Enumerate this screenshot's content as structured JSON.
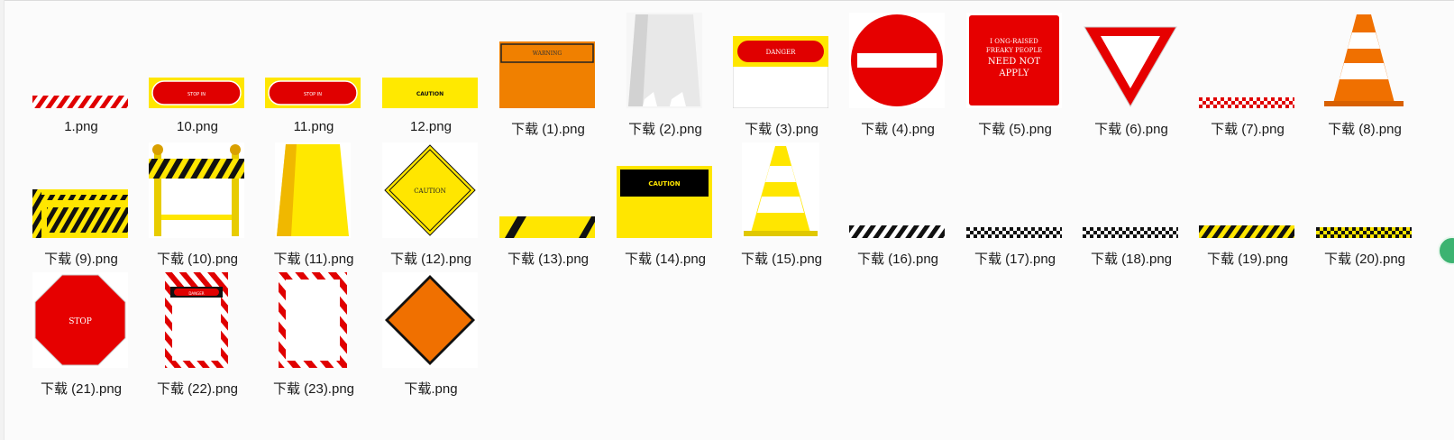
{
  "files": [
    {
      "name": "1.png",
      "icon": "red-white-stripe-bar-icon"
    },
    {
      "name": "10.png",
      "icon": "red-pill-on-yellow-sign-icon"
    },
    {
      "name": "11.png",
      "icon": "red-pill-on-yellow-sign-icon"
    },
    {
      "name": "12.png",
      "icon": "caution-yellow-bar-icon"
    },
    {
      "name": "下载 (1).png",
      "icon": "orange-warning-board-icon"
    },
    {
      "name": "下载 (2).png",
      "icon": "white-a-frame-board-icon"
    },
    {
      "name": "下载 (3).png",
      "icon": "danger-sign-icon"
    },
    {
      "name": "下载 (4).png",
      "icon": "no-entry-sign-icon"
    },
    {
      "name": "下载 (5).png",
      "icon": "red-notice-sign-icon"
    },
    {
      "name": "下载 (6).png",
      "icon": "yield-sign-icon"
    },
    {
      "name": "下载 (7).png",
      "icon": "red-checker-bar-icon"
    },
    {
      "name": "下载 (8).png",
      "icon": "orange-traffic-cone-icon"
    },
    {
      "name": "下载 (9).png",
      "icon": "yellow-black-barrier-icon"
    },
    {
      "name": "下载 (10).png",
      "icon": "yellow-gate-barrier-icon"
    },
    {
      "name": "下载 (11).png",
      "icon": "yellow-a-frame-board-icon"
    },
    {
      "name": "下载 (12).png",
      "icon": "caution-diamond-sign-icon"
    },
    {
      "name": "下载 (13).png",
      "icon": "yellow-black-stripe-bar-icon"
    },
    {
      "name": "下载 (14).png",
      "icon": "caution-board-icon"
    },
    {
      "name": "下载 (15).png",
      "icon": "yellow-traffic-cone-icon"
    },
    {
      "name": "下载 (16).png",
      "icon": "black-white-stripe-bar-icon"
    },
    {
      "name": "下载 (17).png",
      "icon": "black-checker-bar-icon"
    },
    {
      "name": "下载 (18).png",
      "icon": "black-checker-bar-icon"
    },
    {
      "name": "下载 (19).png",
      "icon": "yellow-black-stripe-bar-icon"
    },
    {
      "name": "下载 (20).png",
      "icon": "yellow-black-checker-bar-icon"
    },
    {
      "name": "下载 (21).png",
      "icon": "stop-sign-icon"
    },
    {
      "name": "下载 (22).png",
      "icon": "red-white-frame-with-label-icon"
    },
    {
      "name": "下载 (23).png",
      "icon": "red-white-frame-icon"
    },
    {
      "name": "下载.png",
      "icon": "orange-diamond-sign-icon"
    }
  ],
  "sign_text": {
    "pill_small": "STOP IN",
    "caution_small": "CAUTION",
    "warning": "WARNING",
    "danger": "DANGER",
    "notice_line1": "I ONG-RAISED",
    "notice_line2": "FREAKY PEOPLE",
    "notice_line3": "NEED NOT",
    "notice_line4": "APPLY",
    "caution_diamond": "CAUTION",
    "caution_board": "CAUTION",
    "stop": "STOP",
    "frame_label": "DANGER"
  }
}
